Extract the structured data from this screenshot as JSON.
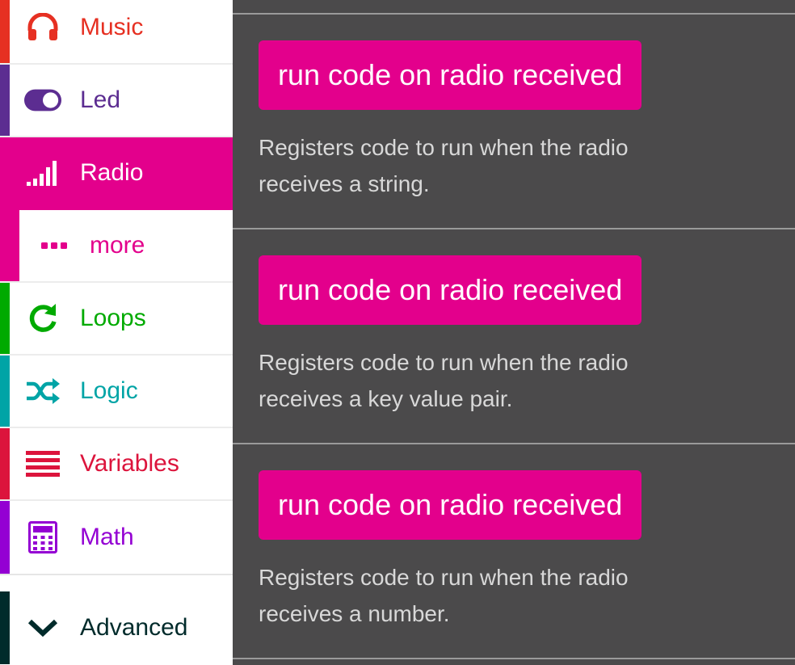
{
  "colors": {
    "music": "#e63022",
    "led": "#5c2d91",
    "radio": "#e3008c",
    "loops": "#00aa00",
    "logic": "#00a4a6",
    "variables": "#dc143c",
    "math": "#9400d3",
    "advanced": "#002b2b",
    "flyout_bg": "#4b4a4b",
    "block": "#e3008c",
    "desc_text": "#d8d8d8"
  },
  "sidebar": {
    "items": [
      {
        "id": "music",
        "label": "Music",
        "icon": "headphones-icon",
        "selected": false
      },
      {
        "id": "led",
        "label": "Led",
        "icon": "toggle-icon",
        "selected": false
      },
      {
        "id": "radio",
        "label": "Radio",
        "icon": "signal-bars-icon",
        "selected": true
      },
      {
        "id": "more",
        "label": "more",
        "icon": "ellipsis-icon",
        "selected": false,
        "sub": true
      },
      {
        "id": "loops",
        "label": "Loops",
        "icon": "refresh-icon",
        "selected": false
      },
      {
        "id": "logic",
        "label": "Logic",
        "icon": "shuffle-icon",
        "selected": false
      },
      {
        "id": "variables",
        "label": "Variables",
        "icon": "list-icon",
        "selected": false
      },
      {
        "id": "math",
        "label": "Math",
        "icon": "calculator-icon",
        "selected": false
      }
    ],
    "advanced": {
      "label": "Advanced",
      "icon": "chevron-down-icon"
    }
  },
  "flyout": {
    "blocks": [
      {
        "label": "run code on radio received",
        "description": "Registers code to run when the radio receives a string."
      },
      {
        "label": "run code on radio received",
        "description": "Registers code to run when the radio receives a key value pair."
      },
      {
        "label": "run code on radio received",
        "description": "Registers code to run when the radio receives a number."
      }
    ]
  }
}
